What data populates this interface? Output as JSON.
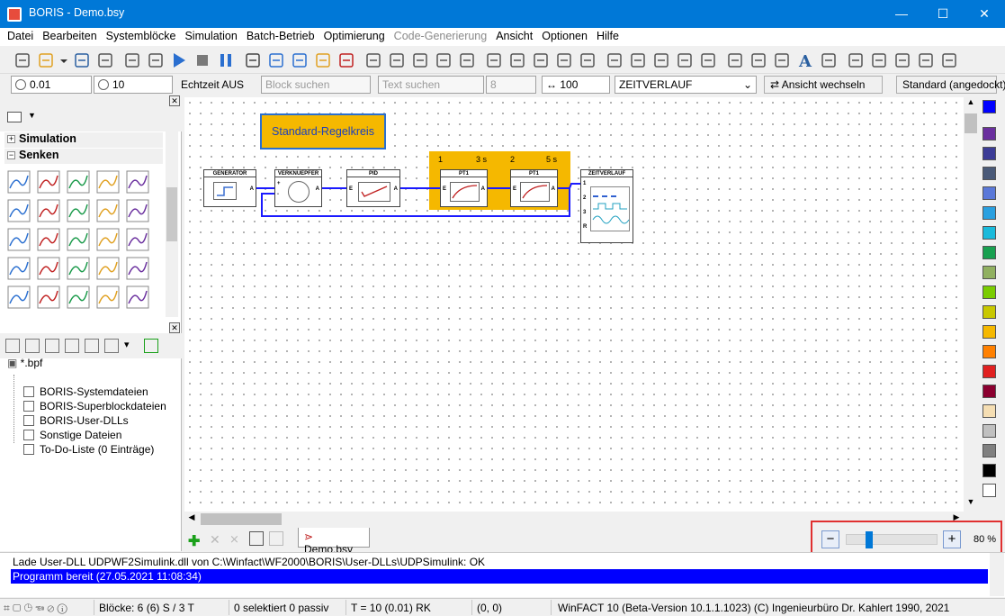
{
  "window": {
    "title": "BORIS - Demo.bsy",
    "minimize": "—",
    "maximize": "☐",
    "close": "✕"
  },
  "menu": [
    "Datei",
    "Bearbeiten",
    "Systemblöcke",
    "Simulation",
    "Batch-Betrieb",
    "Optimierung",
    "Code-Generierung",
    "Ansicht",
    "Optionen",
    "Hilfe"
  ],
  "menu_disabled": [
    6
  ],
  "toolbar2": {
    "step_value": "0.01",
    "time_value": "10",
    "realtime": "Echtzeit AUS",
    "block_search_placeholder": "Block suchen",
    "text_search_placeholder": "Text suchen",
    "number_value": "8",
    "width_value": "100",
    "view_select": "ZEITVERLAUF",
    "switch_view": "Ansicht wechseln",
    "layout": "Standard (angedockt)"
  },
  "palette": {
    "groups": [
      {
        "label": "Simulation",
        "expanded": false
      },
      {
        "label": "Senken",
        "expanded": true
      }
    ]
  },
  "project": {
    "root": "*.bpf",
    "items": [
      "BORIS-Systemdateien",
      "BORIS-Superblockdateien",
      "BORIS-User-DLLs",
      "Sonstige Dateien",
      "To-Do-Liste (0 Einträge)"
    ]
  },
  "diagram": {
    "title_block": "Standard-Regelkreis",
    "blocks": [
      {
        "name": "GENERATOR",
        "out": "A"
      },
      {
        "name": "VERKNUEPFER",
        "out": "A",
        "in_plus": "+",
        "in_minus": "-"
      },
      {
        "name": "PID",
        "in": "E",
        "out": "A"
      },
      {
        "name": "PT1",
        "in": "E",
        "out": "A",
        "num": "1",
        "param": "3 s"
      },
      {
        "name": "PT1",
        "in": "E",
        "out": "A",
        "num": "2",
        "param": "5 s"
      },
      {
        "name": "ZEITVERLAUF",
        "ports": [
          "1",
          "2",
          "3",
          "R"
        ]
      }
    ],
    "highlight_color": "#f5b800"
  },
  "tabs": {
    "active": "Demo.bsy"
  },
  "zoom": {
    "percent": "80 %",
    "level": 0.25,
    "minus": "−",
    "plus": "+"
  },
  "messages": [
    {
      "text": "Lade User-DLL UDPWF2Simulink.dll von C:\\Winfact\\WF2000\\BORIS\\User-DLLs\\UDPSimulink: OK",
      "color": "#1a8a1a"
    },
    {
      "text": "Programm bereit   (27.05.2021 11:08:34)",
      "color": "#ffffff",
      "bg": "#0000ff"
    }
  ],
  "status": {
    "blocks": "Blöcke: 6 (6) S / 3 T",
    "selection": "0 selektiert  0 passiv",
    "time": "T = 10  (0.01)  RK",
    "coords": "(0, 0)",
    "version": "WinFACT 10 (Beta-Version 10.1.1.1023)  (C) Ingenieurbüro Dr. Kahlert 1990, 2021"
  },
  "colors": {
    "palette": [
      "#0000ff",
      "#6a2f9e",
      "#3c3c96",
      "#4a5a78",
      "#5a78d8",
      "#2aa0e0",
      "#1abadb",
      "#18a050",
      "#90b060",
      "#7acc00",
      "#c8c800",
      "#f5b800",
      "#ff8000",
      "#e02020",
      "#8b0030",
      "#f5deb3",
      "#c0c0c0",
      "#808080",
      "#000000",
      "#ffffff"
    ]
  }
}
